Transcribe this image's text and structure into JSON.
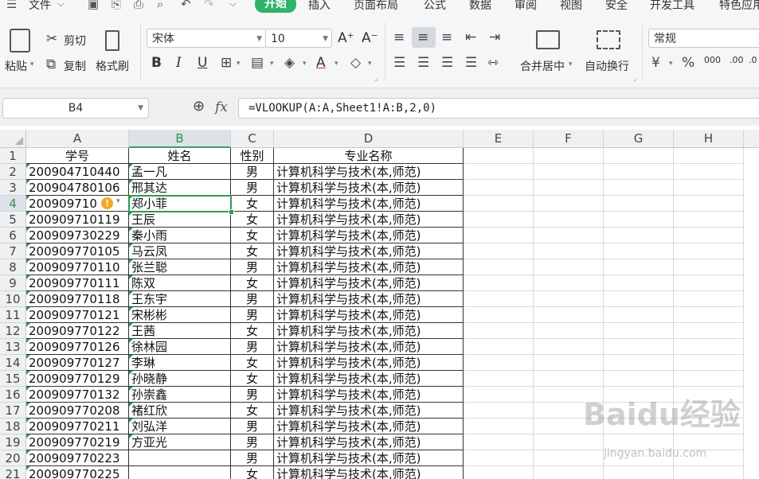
{
  "menubar": {
    "file_label": "文件",
    "tabs": [
      "开始",
      "插入",
      "页面布局",
      "公式",
      "数据",
      "审阅",
      "视图",
      "安全",
      "开发工具",
      "特色应用"
    ]
  },
  "ribbon": {
    "paste_label": "粘贴",
    "cut_label": "剪切",
    "copy_label": "复制",
    "format_painter_label": "格式刷",
    "font_name": "宋体",
    "font_size": "10",
    "merge_center_label": "合并居中",
    "wrap_text_label": "自动换行",
    "number_format": "常规",
    "bold": "B",
    "italic": "I",
    "underline": "U"
  },
  "formula_bar": {
    "cell_ref": "B4",
    "fx_label": "fx",
    "formula": "=VLOOKUP(A:A,Sheet1!A:B,2,0)"
  },
  "sheet": {
    "columns": [
      "A",
      "B",
      "C",
      "D",
      "E",
      "F",
      "G",
      "H"
    ],
    "selected_cell": "B4",
    "headers": [
      "学号",
      "姓名",
      "性别",
      "专业名称"
    ],
    "rows": [
      {
        "num": "2",
        "a": "200904710440",
        "b": "孟一凡",
        "c": "男",
        "d": "计算机科学与技术(本,师范)"
      },
      {
        "num": "3",
        "a": "200904780106",
        "b": "邢其达",
        "c": "男",
        "d": "计算机科学与技术(本,师范)"
      },
      {
        "num": "4",
        "a": "200909710",
        "b": "郑小菲",
        "c": "女",
        "d": "计算机科学与技术(本,师范)"
      },
      {
        "num": "5",
        "a": "200909710119",
        "b": "王辰",
        "c": "女",
        "d": "计算机科学与技术(本,师范)"
      },
      {
        "num": "6",
        "a": "200909730229",
        "b": "秦小雨",
        "c": "女",
        "d": "计算机科学与技术(本,师范)"
      },
      {
        "num": "7",
        "a": "200909770105",
        "b": "马云凤",
        "c": "女",
        "d": "计算机科学与技术(本,师范)"
      },
      {
        "num": "8",
        "a": "200909770110",
        "b": "张兰聪",
        "c": "男",
        "d": "计算机科学与技术(本,师范)"
      },
      {
        "num": "9",
        "a": "200909770111",
        "b": "陈双",
        "c": "女",
        "d": "计算机科学与技术(本,师范)"
      },
      {
        "num": "10",
        "a": "200909770118",
        "b": "王东宇",
        "c": "男",
        "d": "计算机科学与技术(本,师范)"
      },
      {
        "num": "11",
        "a": "200909770121",
        "b": "宋彬彬",
        "c": "男",
        "d": "计算机科学与技术(本,师范)"
      },
      {
        "num": "12",
        "a": "200909770122",
        "b": "王茜",
        "c": "女",
        "d": "计算机科学与技术(本,师范)"
      },
      {
        "num": "13",
        "a": "200909770126",
        "b": "徐林园",
        "c": "男",
        "d": "计算机科学与技术(本,师范)"
      },
      {
        "num": "14",
        "a": "200909770127",
        "b": "李琳",
        "c": "女",
        "d": "计算机科学与技术(本,师范)"
      },
      {
        "num": "15",
        "a": "200909770129",
        "b": "孙晓静",
        "c": "女",
        "d": "计算机科学与技术(本,师范)"
      },
      {
        "num": "16",
        "a": "200909770132",
        "b": "孙崇鑫",
        "c": "男",
        "d": "计算机科学与技术(本,师范)"
      },
      {
        "num": "17",
        "a": "200909770208",
        "b": "褚红欣",
        "c": "女",
        "d": "计算机科学与技术(本,师范)"
      },
      {
        "num": "18",
        "a": "200909770211",
        "b": "刘弘洋",
        "c": "男",
        "d": "计算机科学与技术(本,师范)"
      },
      {
        "num": "19",
        "a": "200909770219",
        "b": "方亚光",
        "c": "男",
        "d": "计算机科学与技术(本,师范)"
      },
      {
        "num": "20",
        "a": "200909770223",
        "b": "",
        "c": "男",
        "d": "计算机科学与技术(本,师范)"
      },
      {
        "num": "21",
        "a": "200909770225",
        "b": "",
        "c": "女",
        "d": "计算机科学与技术(本,师范)"
      }
    ]
  },
  "watermark": {
    "brand": "Baidu经验",
    "url": "jingyan.baidu.com"
  },
  "colors": {
    "accent": "#2fb26a",
    "selection": "#2e9a52",
    "warning": "#f5a623"
  }
}
